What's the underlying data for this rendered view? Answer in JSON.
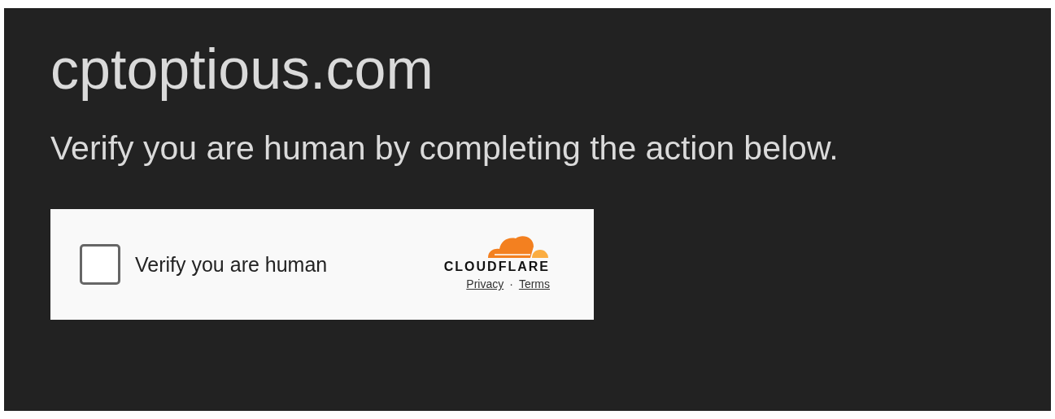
{
  "site": {
    "title": "cptoptious.com"
  },
  "message": "Verify you are human by completing the action below.",
  "widget": {
    "checkbox": {
      "label": "Verify you are human",
      "checked": false
    },
    "brand": "CLOUDFLARE",
    "links": [
      "Privacy",
      "Terms"
    ],
    "separator": "·"
  }
}
